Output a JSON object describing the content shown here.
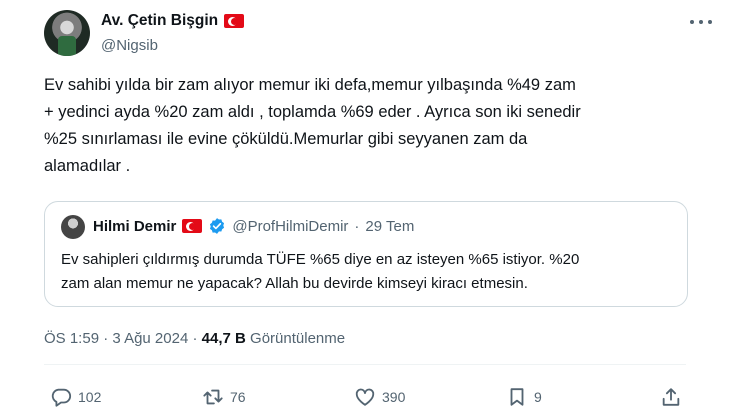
{
  "author": {
    "display_name": "Av. Çetin Bişgin",
    "handle": "@Nigsib"
  },
  "tweet": {
    "lines": [
      "Ev sahibi yılda bir zam alıyor memur iki defa,memur yılbaşında %49 zam",
      "+ yedinci ayda %20 zam aldı , toplamda %69 eder . Ayrıca son iki senedir",
      "%25 sınırlaması ile evine çöküldü.Memurlar gibi seyyanen zam da",
      "alamadılar ."
    ]
  },
  "quote": {
    "display_name": "Hilmi Demir",
    "handle": "@ProfHilmiDemir",
    "separator": "·",
    "date": "29 Tem",
    "lines": [
      "Ev sahipleri çıldırmış durumda TÜFE %65 diye en az isteyen %65 istiyor. %20",
      "zam alan memur ne yapacak? Allah bu devirde kimseyi kiracı etmesin."
    ]
  },
  "meta": {
    "time": "ÖS 1:59",
    "separator": "·",
    "date": "3 Ağu 2024",
    "views_count": "44,7 B",
    "views_label": "Görüntülenme"
  },
  "actions": {
    "replies": "102",
    "retweets": "76",
    "likes": "390",
    "bookmarks": "9"
  },
  "icons": [
    "flag-tr-icon",
    "more-icon",
    "verified-icon",
    "reply-icon",
    "retweet-icon",
    "like-icon",
    "bookmark-icon",
    "share-icon"
  ],
  "colors": {
    "text": "#0f1419",
    "secondary": "#536471",
    "border": "#cfd9de",
    "verified": "#1d9bf0",
    "flag_red": "#e30a17"
  }
}
